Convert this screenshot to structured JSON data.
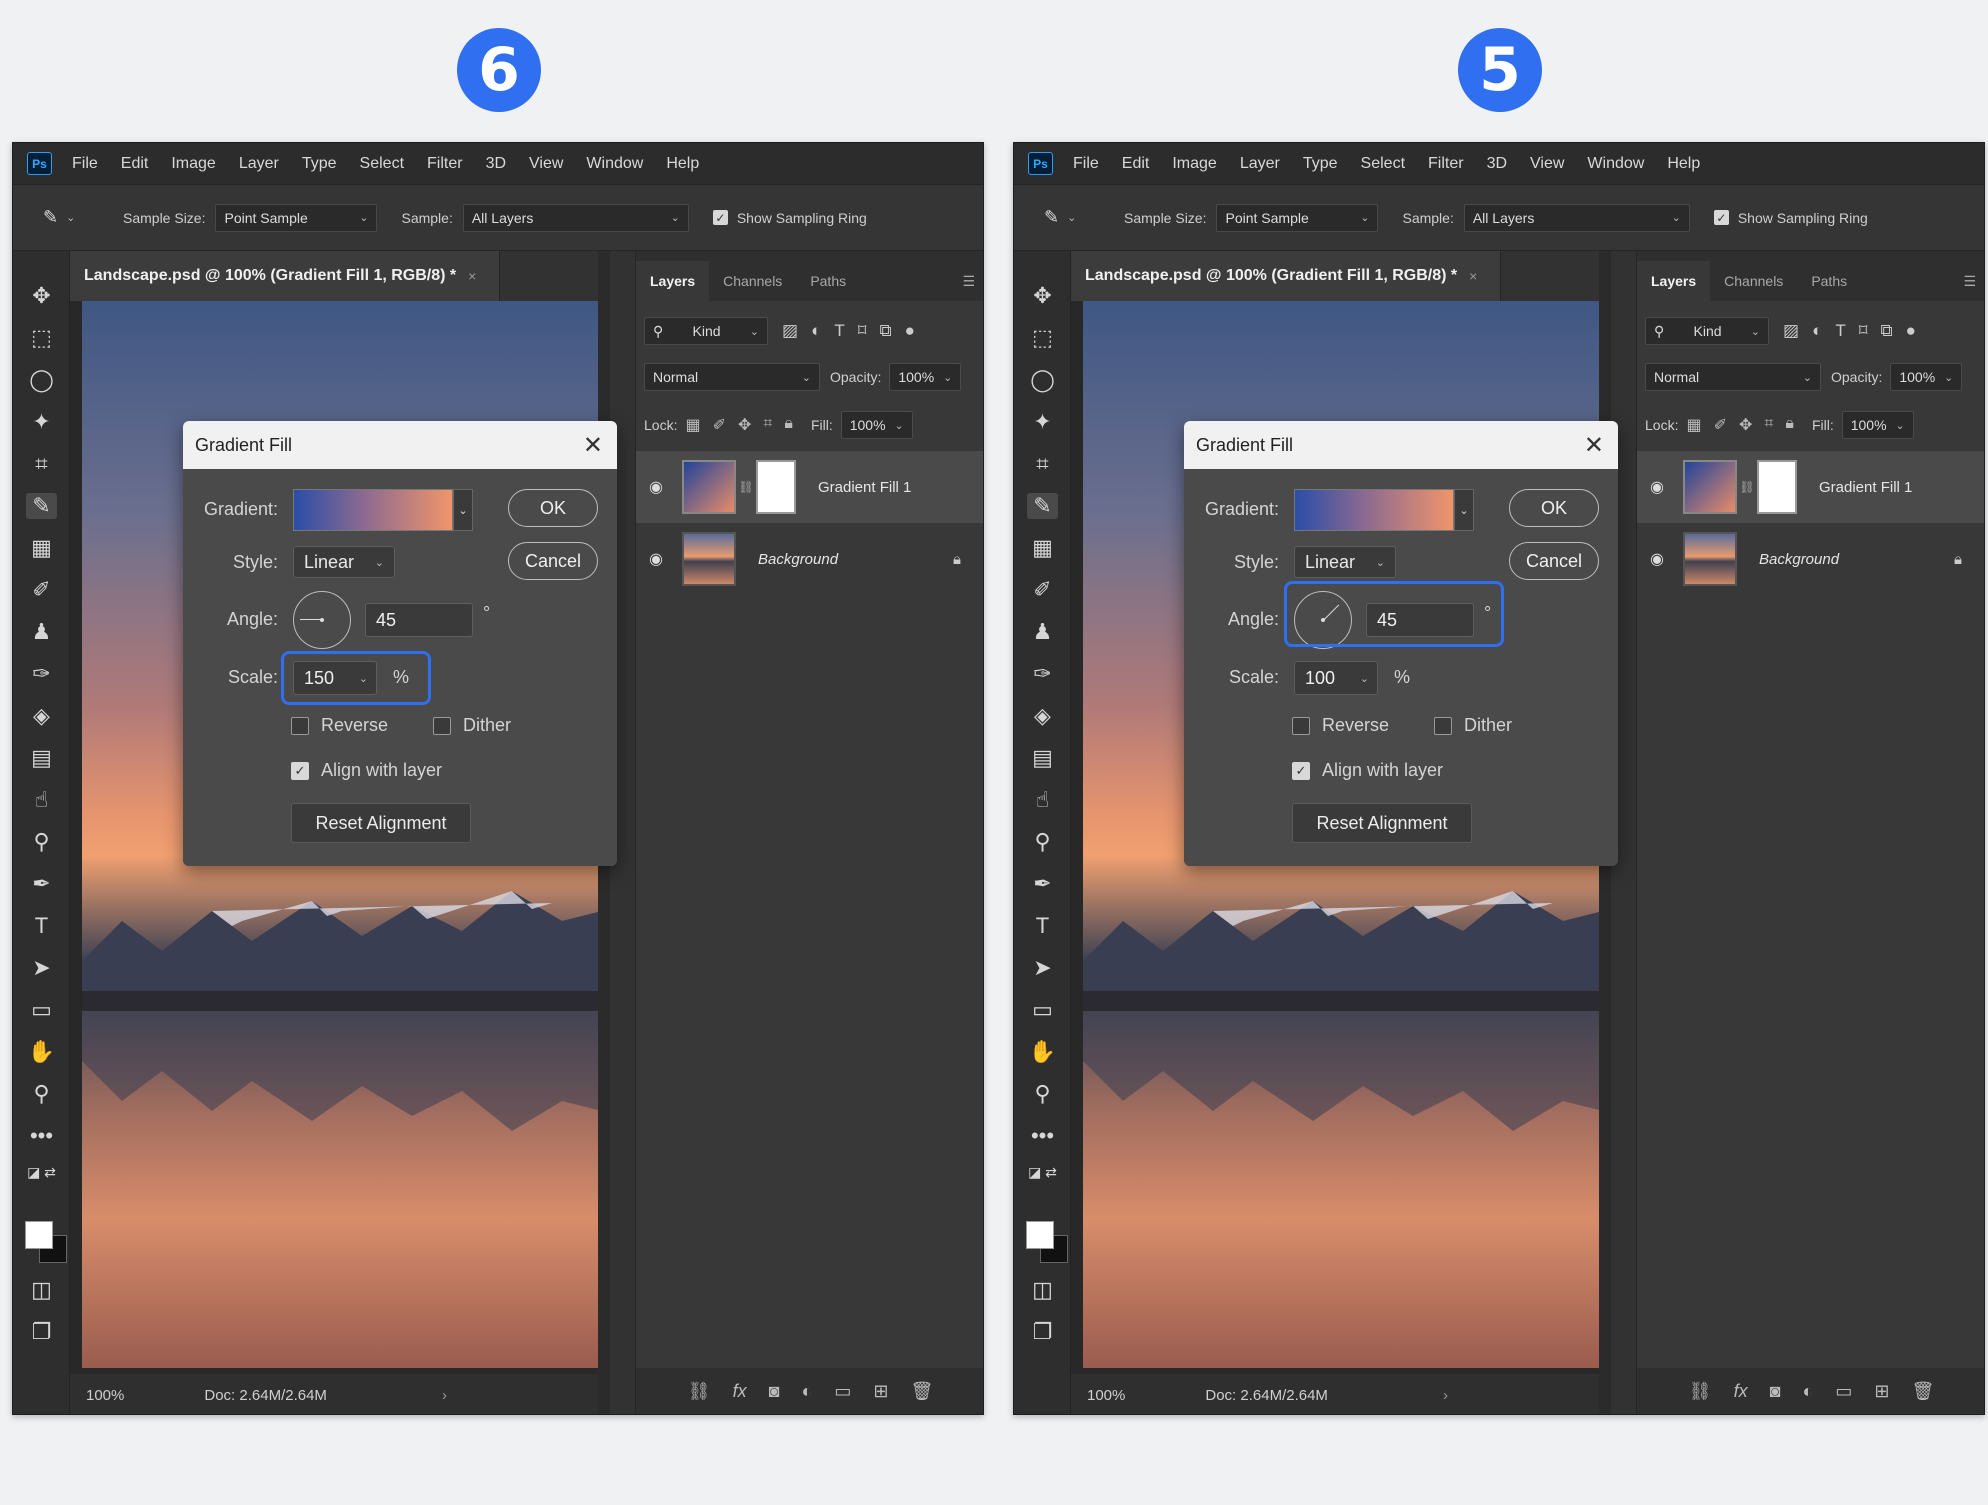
{
  "panels": [
    {
      "step": "6",
      "app_logo": "Ps",
      "menu": [
        "File",
        "Edit",
        "Image",
        "Layer",
        "Type",
        "Select",
        "Filter",
        "3D",
        "View",
        "Window",
        "Help"
      ],
      "options": {
        "sample_size_label": "Sample Size:",
        "sample_size_value": "Point Sample",
        "sample_label": "Sample:",
        "sample_value": "All Layers",
        "show_ring_label": "Show Sampling Ring"
      },
      "doc_tab": {
        "title": "Landscape.psd @ 100% (Gradient Fill 1, RGB/8) *",
        "close": "×"
      },
      "status": {
        "zoom": "100%",
        "doc": "Doc: 2.64M/2.64M",
        "chevron": "›"
      },
      "layers_panel": {
        "tabs": [
          "Layers",
          "Channels",
          "Paths"
        ],
        "kind": "Kind",
        "blend_mode": "Normal",
        "opacity_label": "Opacity:",
        "opacity_value": "100%",
        "lock_label": "Lock:",
        "fill_label": "Fill:",
        "fill_value": "100%",
        "layers": [
          {
            "name": "Gradient Fill 1",
            "selected": true
          },
          {
            "name": "Background",
            "selected": false
          }
        ]
      },
      "dialog": {
        "title": "Gradient Fill",
        "close": "✕",
        "gradient_label": "Gradient:",
        "style_label": "Style:",
        "style_value": "Linear",
        "angle_label": "Angle:",
        "angle_value": "45",
        "angle_unit": "°",
        "scale_label": "Scale:",
        "scale_value": "150",
        "scale_unit": "%",
        "reverse_label": "Reverse",
        "dither_label": "Dither",
        "align_label": "Align with layer",
        "reset_label": "Reset Alignment",
        "ok_label": "OK",
        "cancel_label": "Cancel",
        "reverse_checked": false,
        "dither_checked": false,
        "align_checked": true,
        "highlight": "scale"
      }
    },
    {
      "step": "5",
      "app_logo": "Ps",
      "menu": [
        "File",
        "Edit",
        "Image",
        "Layer",
        "Type",
        "Select",
        "Filter",
        "3D",
        "View",
        "Window",
        "Help"
      ],
      "options": {
        "sample_size_label": "Sample Size:",
        "sample_size_value": "Point Sample",
        "sample_label": "Sample:",
        "sample_value": "All Layers",
        "show_ring_label": "Show Sampling Ring"
      },
      "doc_tab": {
        "title": "Landscape.psd @ 100% (Gradient Fill 1, RGB/8) *",
        "close": "×"
      },
      "status": {
        "zoom": "100%",
        "doc": "Doc: 2.64M/2.64M",
        "chevron": "›"
      },
      "layers_panel": {
        "tabs": [
          "Layers",
          "Channels",
          "Paths"
        ],
        "kind": "Kind",
        "blend_mode": "Normal",
        "opacity_label": "Opacity:",
        "opacity_value": "100%",
        "lock_label": "Lock:",
        "fill_label": "Fill:",
        "fill_value": "100%",
        "layers": [
          {
            "name": "Gradient Fill 1",
            "selected": true
          },
          {
            "name": "Background",
            "selected": false
          }
        ]
      },
      "dialog": {
        "title": "Gradient Fill",
        "close": "✕",
        "gradient_label": "Gradient:",
        "style_label": "Style:",
        "style_value": "Linear",
        "angle_label": "Angle:",
        "angle_value": "45",
        "angle_unit": "°",
        "scale_label": "Scale:",
        "scale_value": "100",
        "scale_unit": "%",
        "reverse_label": "Reverse",
        "dither_label": "Dither",
        "align_label": "Align with layer",
        "reset_label": "Reset Alignment",
        "ok_label": "OK",
        "cancel_label": "Cancel",
        "reverse_checked": false,
        "dither_checked": false,
        "align_checked": true,
        "highlight": "angle"
      }
    }
  ],
  "colors": {
    "badge": "#2f6ff0",
    "highlight": "#2f6ff0",
    "ps_bg": "#323232"
  }
}
